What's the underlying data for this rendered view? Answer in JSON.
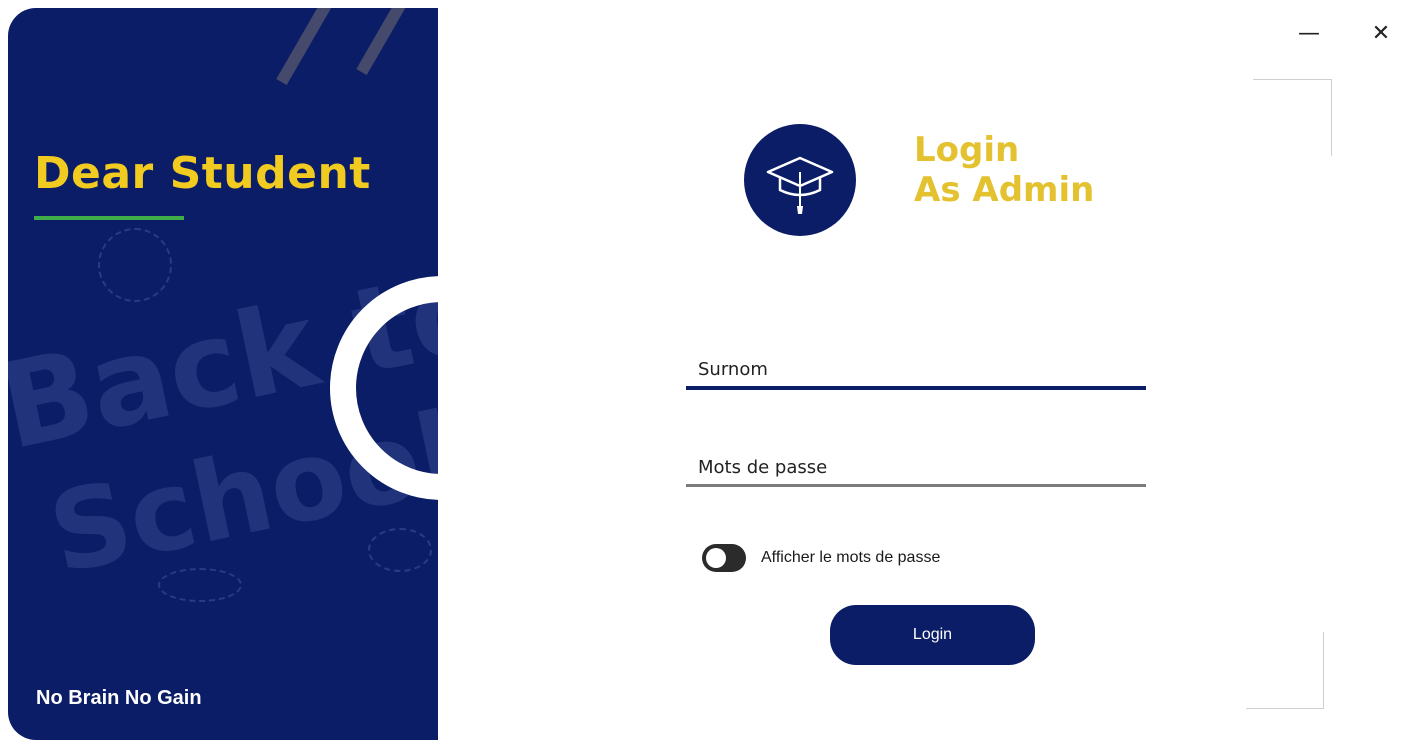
{
  "window": {
    "minimize_label": "—",
    "close_label": "✕"
  },
  "left_panel": {
    "title": "Dear Student",
    "background_text_1": "Back to",
    "background_text_2": "School",
    "motto": "No Brain No Gain"
  },
  "header": {
    "logo_icon": "graduation-cap-icon",
    "title_line_1": "Login",
    "title_line_2": "As Admin"
  },
  "form": {
    "username_placeholder": "Surnom",
    "username_value": "",
    "password_placeholder": "Mots de passe",
    "password_value": "",
    "show_password_label": "Afficher le mots de passe",
    "show_password_on": false,
    "login_label": "Login"
  },
  "colors": {
    "navy": "#0a1d66",
    "yellow": "#e3c12f",
    "accent_green": "#3fae49"
  }
}
